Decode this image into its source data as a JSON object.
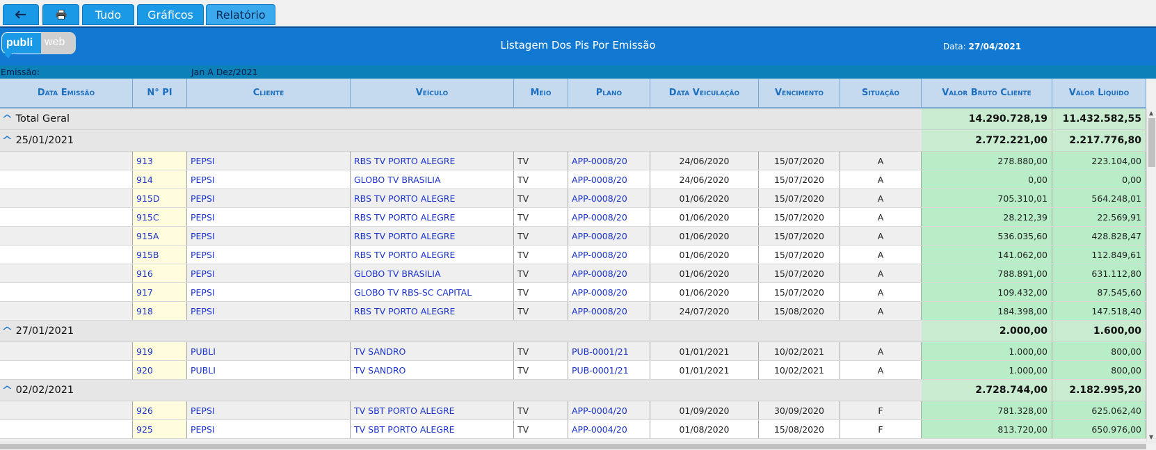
{
  "toolbar": {
    "back_icon": "back-arrow-icon",
    "print_icon": "printer-icon",
    "tabs": [
      "Tudo",
      "Gráficos",
      "Relatório"
    ],
    "active_tab": "Relatório"
  },
  "header": {
    "logo_part1": "publi",
    "logo_part2": "web",
    "title": "Listagem Dos Pis Por Emissão",
    "date_label": "Data:",
    "date_value": "27/04/2021"
  },
  "filter": {
    "label": "Emissão:",
    "value": "Jan A Dez/2021"
  },
  "columns": [
    "Data Emissão",
    "N° PI",
    "Cliente",
    "Veículo",
    "Meio",
    "Plano",
    "Data Veiculação",
    "Vencimento",
    "Situação",
    "Valor Bruto Cliente",
    "Valor Líquido"
  ],
  "total": {
    "label": "Total Geral",
    "bruto": "14.290.728,19",
    "liquido": "11.432.582,55"
  },
  "groups": [
    {
      "date": "25/01/2021",
      "bruto": "2.772.221,00",
      "liquido": "2.217.776,80",
      "rows": [
        {
          "pi": "913",
          "cliente": "PEPSI",
          "veiculo": "RBS TV PORTO ALEGRE",
          "meio": "TV",
          "plano": "APP-0008/20",
          "veiculacao": "24/06/2020",
          "vencimento": "15/07/2020",
          "situacao": "A",
          "bruto": "278.880,00",
          "liquido": "223.104,00"
        },
        {
          "pi": "914",
          "cliente": "PEPSI",
          "veiculo": "GLOBO TV BRASILIA",
          "meio": "TV",
          "plano": "APP-0008/20",
          "veiculacao": "24/06/2020",
          "vencimento": "15/07/2020",
          "situacao": "A",
          "bruto": "0,00",
          "liquido": "0,00"
        },
        {
          "pi": "915D",
          "cliente": "PEPSI",
          "veiculo": "RBS TV PORTO ALEGRE",
          "meio": "TV",
          "plano": "APP-0008/20",
          "veiculacao": "01/06/2020",
          "vencimento": "15/07/2020",
          "situacao": "A",
          "bruto": "705.310,01",
          "liquido": "564.248,01"
        },
        {
          "pi": "915C",
          "cliente": "PEPSI",
          "veiculo": "RBS TV PORTO ALEGRE",
          "meio": "TV",
          "plano": "APP-0008/20",
          "veiculacao": "01/06/2020",
          "vencimento": "15/07/2020",
          "situacao": "A",
          "bruto": "28.212,39",
          "liquido": "22.569,91"
        },
        {
          "pi": "915A",
          "cliente": "PEPSI",
          "veiculo": "RBS TV PORTO ALEGRE",
          "meio": "TV",
          "plano": "APP-0008/20",
          "veiculacao": "01/06/2020",
          "vencimento": "15/07/2020",
          "situacao": "A",
          "bruto": "536.035,60",
          "liquido": "428.828,47"
        },
        {
          "pi": "915B",
          "cliente": "PEPSI",
          "veiculo": "RBS TV PORTO ALEGRE",
          "meio": "TV",
          "plano": "APP-0008/20",
          "veiculacao": "01/06/2020",
          "vencimento": "15/07/2020",
          "situacao": "A",
          "bruto": "141.062,00",
          "liquido": "112.849,61"
        },
        {
          "pi": "916",
          "cliente": "PEPSI",
          "veiculo": "GLOBO TV BRASILIA",
          "meio": "TV",
          "plano": "APP-0008/20",
          "veiculacao": "01/06/2020",
          "vencimento": "15/07/2020",
          "situacao": "A",
          "bruto": "788.891,00",
          "liquido": "631.112,80"
        },
        {
          "pi": "917",
          "cliente": "PEPSI",
          "veiculo": "GLOBO TV RBS-SC CAPITAL",
          "meio": "TV",
          "plano": "APP-0008/20",
          "veiculacao": "01/06/2020",
          "vencimento": "15/07/2020",
          "situacao": "A",
          "bruto": "109.432,00",
          "liquido": "87.545,60"
        },
        {
          "pi": "918",
          "cliente": "PEPSI",
          "veiculo": "RBS TV PORTO ALEGRE",
          "meio": "TV",
          "plano": "APP-0008/20",
          "veiculacao": "24/07/2020",
          "vencimento": "15/08/2020",
          "situacao": "A",
          "bruto": "184.398,00",
          "liquido": "147.518,40"
        }
      ]
    },
    {
      "date": "27/01/2021",
      "bruto": "2.000,00",
      "liquido": "1.600,00",
      "rows": [
        {
          "pi": "919",
          "cliente": "PUBLI",
          "veiculo": "TV SANDRO",
          "meio": "TV",
          "plano": "PUB-0001/21",
          "veiculacao": "01/01/2021",
          "vencimento": "10/02/2021",
          "situacao": "A",
          "bruto": "1.000,00",
          "liquido": "800,00"
        },
        {
          "pi": "920",
          "cliente": "PUBLI",
          "veiculo": "TV SANDRO",
          "meio": "TV",
          "plano": "PUB-0001/21",
          "veiculacao": "01/01/2021",
          "vencimento": "10/02/2021",
          "situacao": "A",
          "bruto": "1.000,00",
          "liquido": "800,00"
        }
      ]
    },
    {
      "date": "02/02/2021",
      "bruto": "2.728.744,00",
      "liquido": "2.182.995,20",
      "rows": [
        {
          "pi": "926",
          "cliente": "PEPSI",
          "veiculo": "TV SBT PORTO ALEGRE",
          "meio": "TV",
          "plano": "APP-0004/20",
          "veiculacao": "01/09/2020",
          "vencimento": "30/09/2020",
          "situacao": "F",
          "bruto": "781.328,00",
          "liquido": "625.062,40"
        },
        {
          "pi": "925",
          "cliente": "PEPSI",
          "veiculo": "TV SBT PORTO ALEGRE",
          "meio": "TV",
          "plano": "APP-0004/20",
          "veiculacao": "01/08/2020",
          "vencimento": "15/08/2020",
          "situacao": "F",
          "bruto": "813.720,00",
          "liquido": "650.976,00"
        }
      ]
    }
  ],
  "colors": {
    "header_blue": "#1279d3",
    "tab_blue": "#1a9ae6",
    "column_header_bg": "#c5d9ef",
    "value_green": "#b9edc8",
    "pi_yellow": "#fffbdd",
    "link_blue": "#1a33cc"
  }
}
